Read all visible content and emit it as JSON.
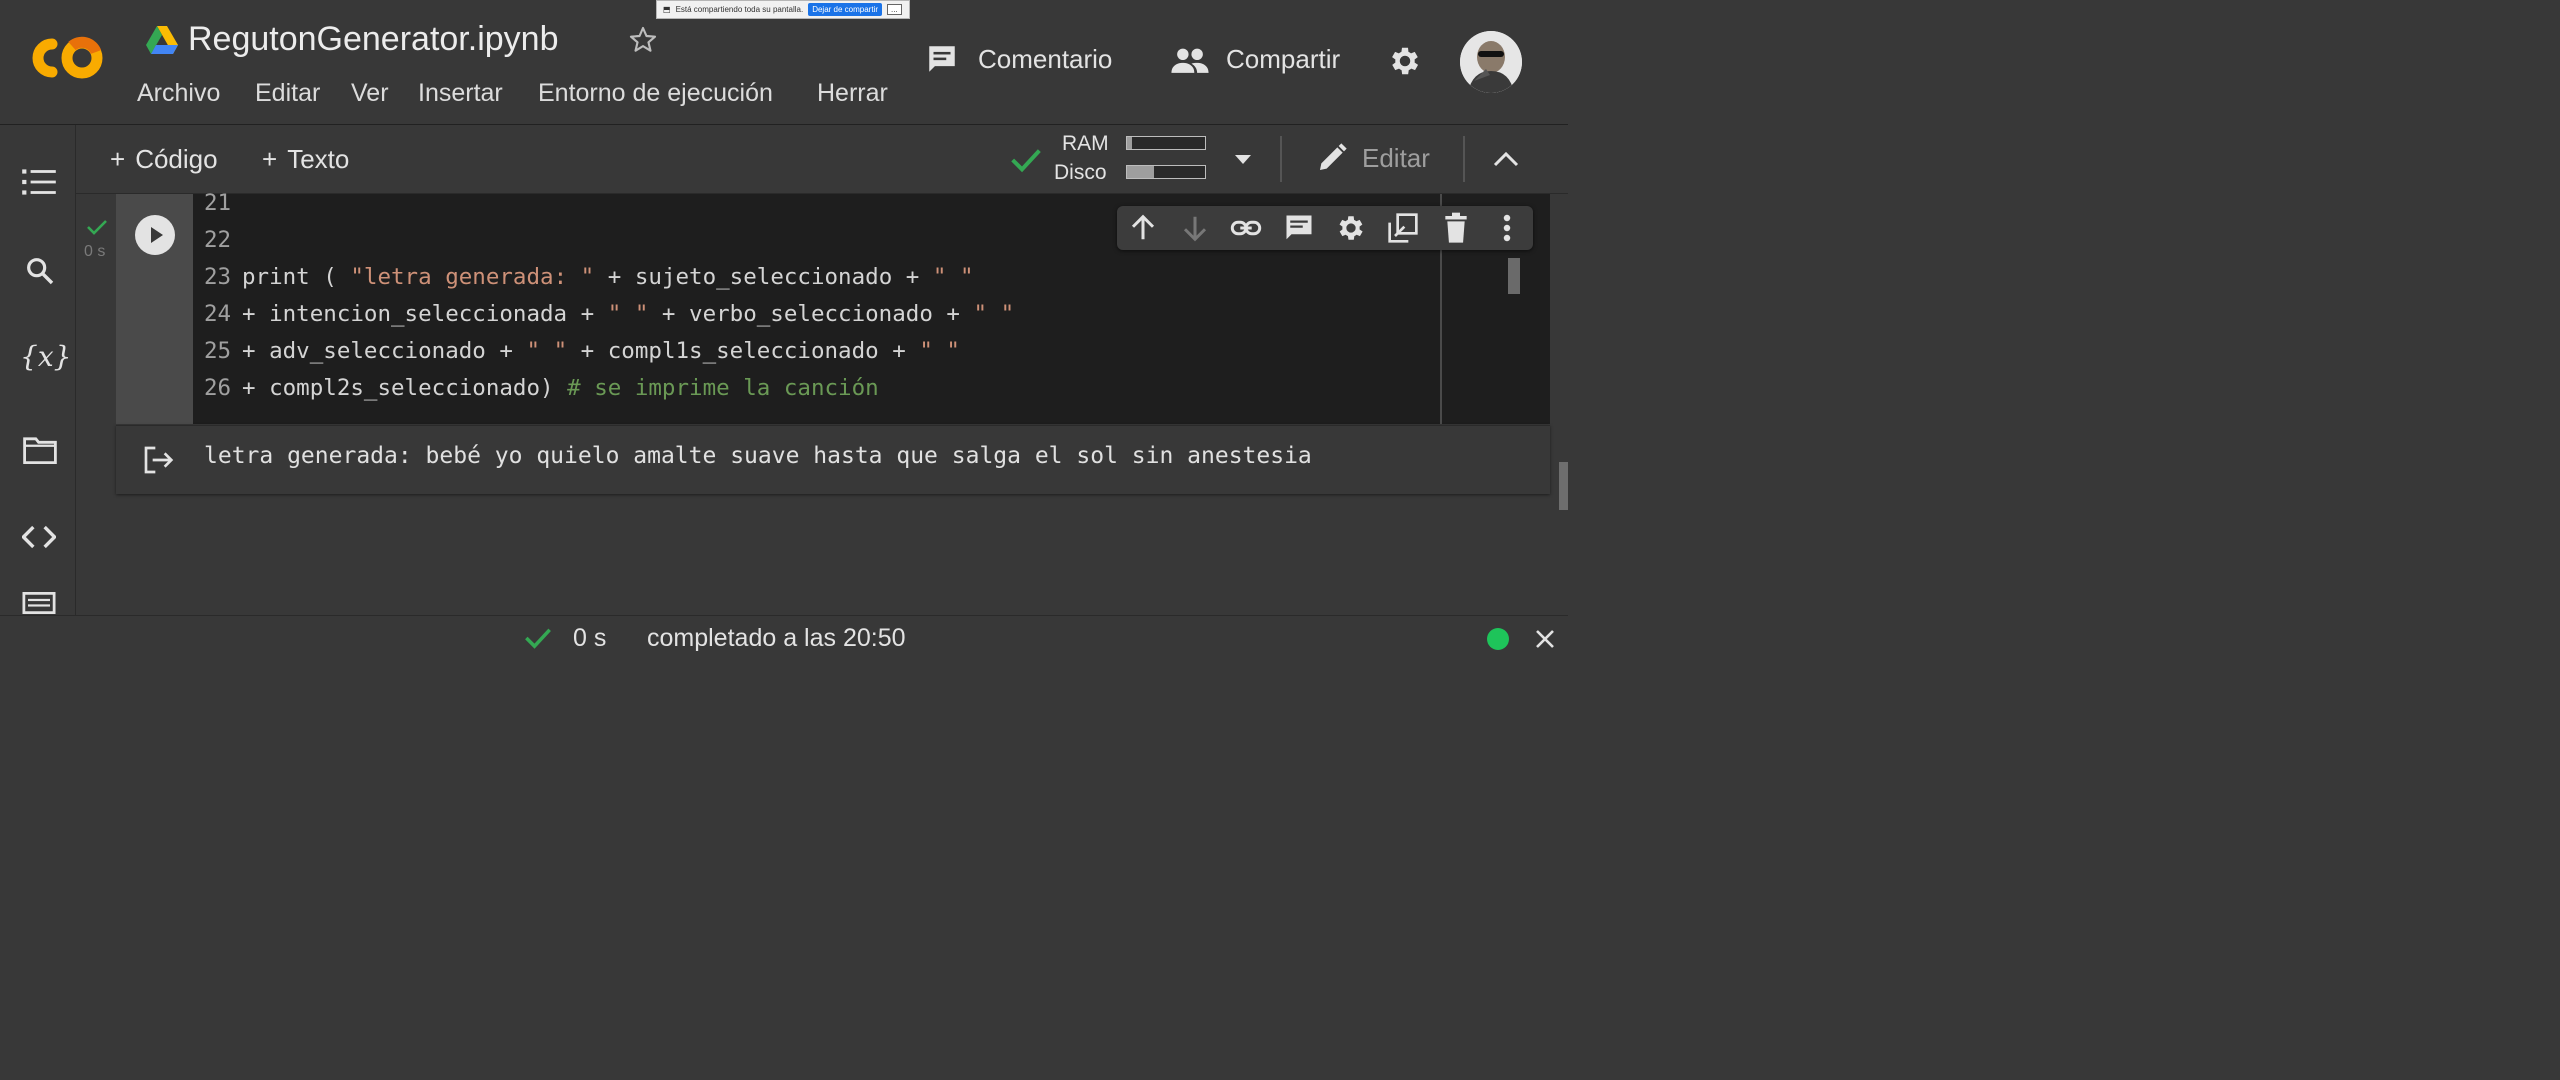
{
  "share_banner": {
    "message": "Está compartiendo toda su pantalla.",
    "stop_label": "Dejar de compartir",
    "more_label": "..."
  },
  "header": {
    "file_name": "RegutonGenerator.ipynb",
    "menu": [
      "Archivo",
      "Editar",
      "Ver",
      "Insertar",
      "Entorno de ejecución",
      "Herrar"
    ],
    "comment_label": "Comentario",
    "share_label": "Compartir"
  },
  "toolbar": {
    "add_code": "Código",
    "add_text": "Texto",
    "ram_label": "RAM",
    "disk_label": "Disco",
    "ram_usage": 0.06,
    "disk_usage": 0.35,
    "edit_label": "Editar"
  },
  "cell": {
    "exec_time": "0 s",
    "lines": [
      {
        "num": "21",
        "text": ""
      },
      {
        "num": "22",
        "text": ""
      },
      {
        "num": "23",
        "text": "print ( \"letra generada: \" + sujeto_seleccionado + \" \""
      },
      {
        "num": "24",
        "text": "+ intencion_seleccionada + \" \" + verbo_seleccionado + \" \""
      },
      {
        "num": "25",
        "text": "+ adv_seleccionado + \" \" + compl1s_seleccionado + \" \""
      },
      {
        "num": "26",
        "text": "+ compl2s_seleccionado) # se imprime la canción"
      }
    ],
    "output": "letra generada: bebé yo quielo amalte suave hasta que salga el sol sin anestesia"
  },
  "status": {
    "time": "0 s",
    "message": "completado a las 20:50"
  },
  "colors": {
    "accent_green": "#34a853",
    "logo_orange": "#f9ab00",
    "logo_dark_orange": "#e8710a",
    "string": "#ce9178",
    "comment": "#6a9955"
  }
}
